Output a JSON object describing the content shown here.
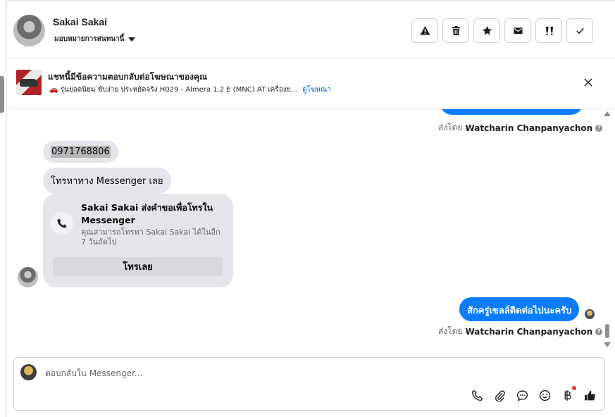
{
  "header": {
    "contact_name": "Sakai Sakai",
    "assign_label": "มอบหมายการสนทนานี้",
    "actions": [
      {
        "name": "report-spam-button",
        "icon": "warning-icon"
      },
      {
        "name": "delete-button",
        "icon": "trash-icon"
      },
      {
        "name": "star-button",
        "icon": "star-icon"
      },
      {
        "name": "mark-unread-button",
        "icon": "envelope-icon"
      },
      {
        "name": "follow-up-button",
        "icon": "follow-up-icon"
      },
      {
        "name": "mark-done-button",
        "icon": "check-icon"
      }
    ]
  },
  "ad_banner": {
    "title": "แชทนี้มีข้อความตอบกลับต่อโฆษณาของคุณ",
    "subtitle": "🚗 รุ่นยอดนิยม ขับง่าย ประหยัดจริง H029 - Almera 1.2 E (MNC) AT เครื่องย...",
    "link": "ดูโฆษณา"
  },
  "messages": {
    "sent_by_prefix": "ส่งโดย",
    "sender_name": "Watcharin Chanpanyachon",
    "incoming_phone": "0971768806",
    "incoming_text": "โทรหาทาง Messenger เลย",
    "call_card": {
      "title": "Sakai Sakai ส่งคำขอเพื่อโทรใน Messenger",
      "description": "คุณสามารถโทรหา Sakai Sakai ได้ในอีก 7 วันถัดไป",
      "button": "โทรเลย"
    },
    "outgoing_text": "สักครู่เซลล์ติดต่อไปนะครับ"
  },
  "composer": {
    "placeholder": "ตอบกลับใน Messenger...",
    "tools": [
      "phone-icon",
      "paperclip-icon",
      "saved-reply-icon",
      "emoji-icon",
      "baht-icon",
      "thumbs-up-icon"
    ],
    "accent": "#0a7cff"
  }
}
